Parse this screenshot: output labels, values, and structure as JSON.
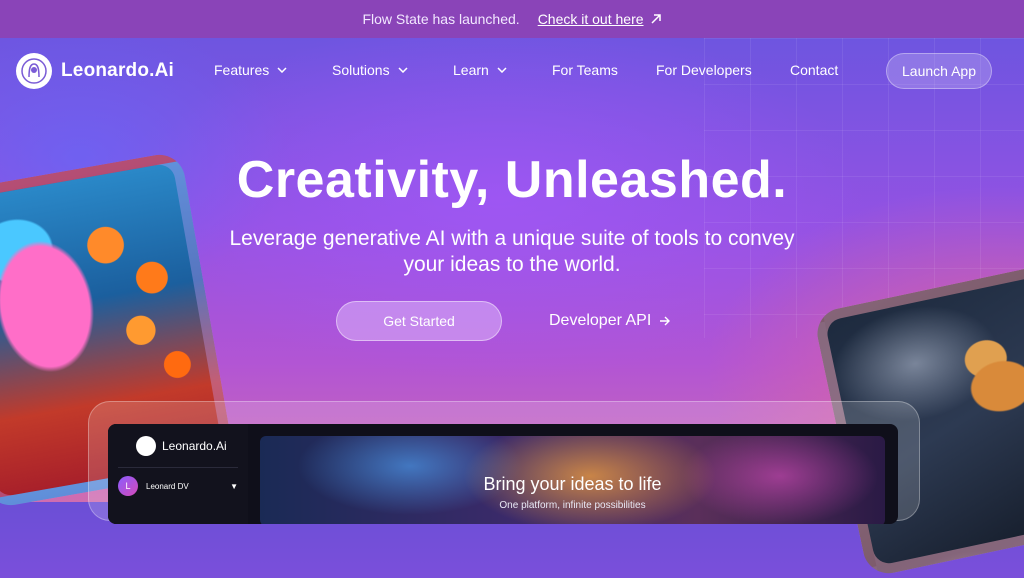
{
  "announcement": {
    "text": "Flow State has launched.",
    "link_label": "Check it out here"
  },
  "nav": {
    "brand": "Leonardo.Ai",
    "items": [
      {
        "label": "Features",
        "has_dropdown": true
      },
      {
        "label": "Solutions",
        "has_dropdown": true
      },
      {
        "label": "Learn",
        "has_dropdown": true
      },
      {
        "label": "For Teams",
        "has_dropdown": false
      },
      {
        "label": "For Developers",
        "has_dropdown": false
      },
      {
        "label": "Contact",
        "has_dropdown": false
      }
    ],
    "launch_label": "Launch App"
  },
  "hero": {
    "headline": "Creativity, Unleashed.",
    "subline": "Leverage generative AI with a unique suite of tools to convey your ideas to the world.",
    "cta_primary": "Get Started",
    "cta_secondary": "Developer API"
  },
  "app_preview": {
    "brand": "Leonardo.Ai",
    "user_initial": "L",
    "user_name": "Leonard DV",
    "banner_title": "Bring your ideas to life",
    "banner_subtitle": "One platform, infinite possibilities"
  },
  "colors": {
    "announcement_bg": "#8a44b8",
    "accent_purple": "#9352e3",
    "accent_pink": "#cf6db0"
  }
}
